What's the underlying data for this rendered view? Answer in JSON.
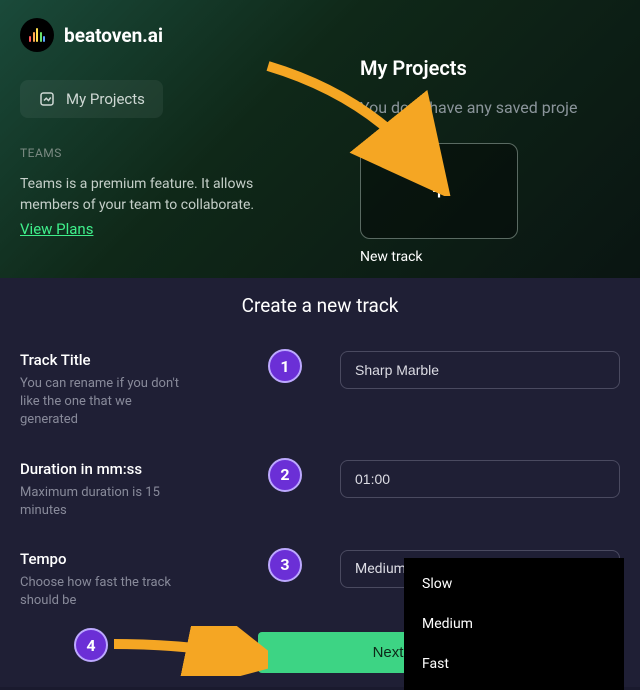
{
  "brand": {
    "name": "beatoven.ai"
  },
  "sidebar": {
    "nav_item": "My Projects",
    "teams_label": "TEAMS",
    "teams_desc": "Teams is a premium feature. It allows members of your team to collaborate.",
    "view_plans": "View Plans"
  },
  "projects": {
    "title": "My Projects",
    "empty": "You don't have any saved proje",
    "new_track_label": "New track",
    "plus": "+"
  },
  "form": {
    "title": "Create a new track",
    "track_title": {
      "label": "Track Title",
      "desc": "You can rename if you don't like the one that we generated",
      "value": "Sharp Marble",
      "step": "1"
    },
    "duration": {
      "label": "Duration in mm:ss",
      "desc": "Maximum duration is 15 minutes",
      "value": "01:00",
      "step": "2"
    },
    "tempo": {
      "label": "Tempo",
      "desc": "Choose how fast the track should be",
      "value": "Medium",
      "step": "3",
      "options": [
        "Slow",
        "Medium",
        "Fast"
      ]
    },
    "next_label": "Next",
    "step4": "4"
  }
}
